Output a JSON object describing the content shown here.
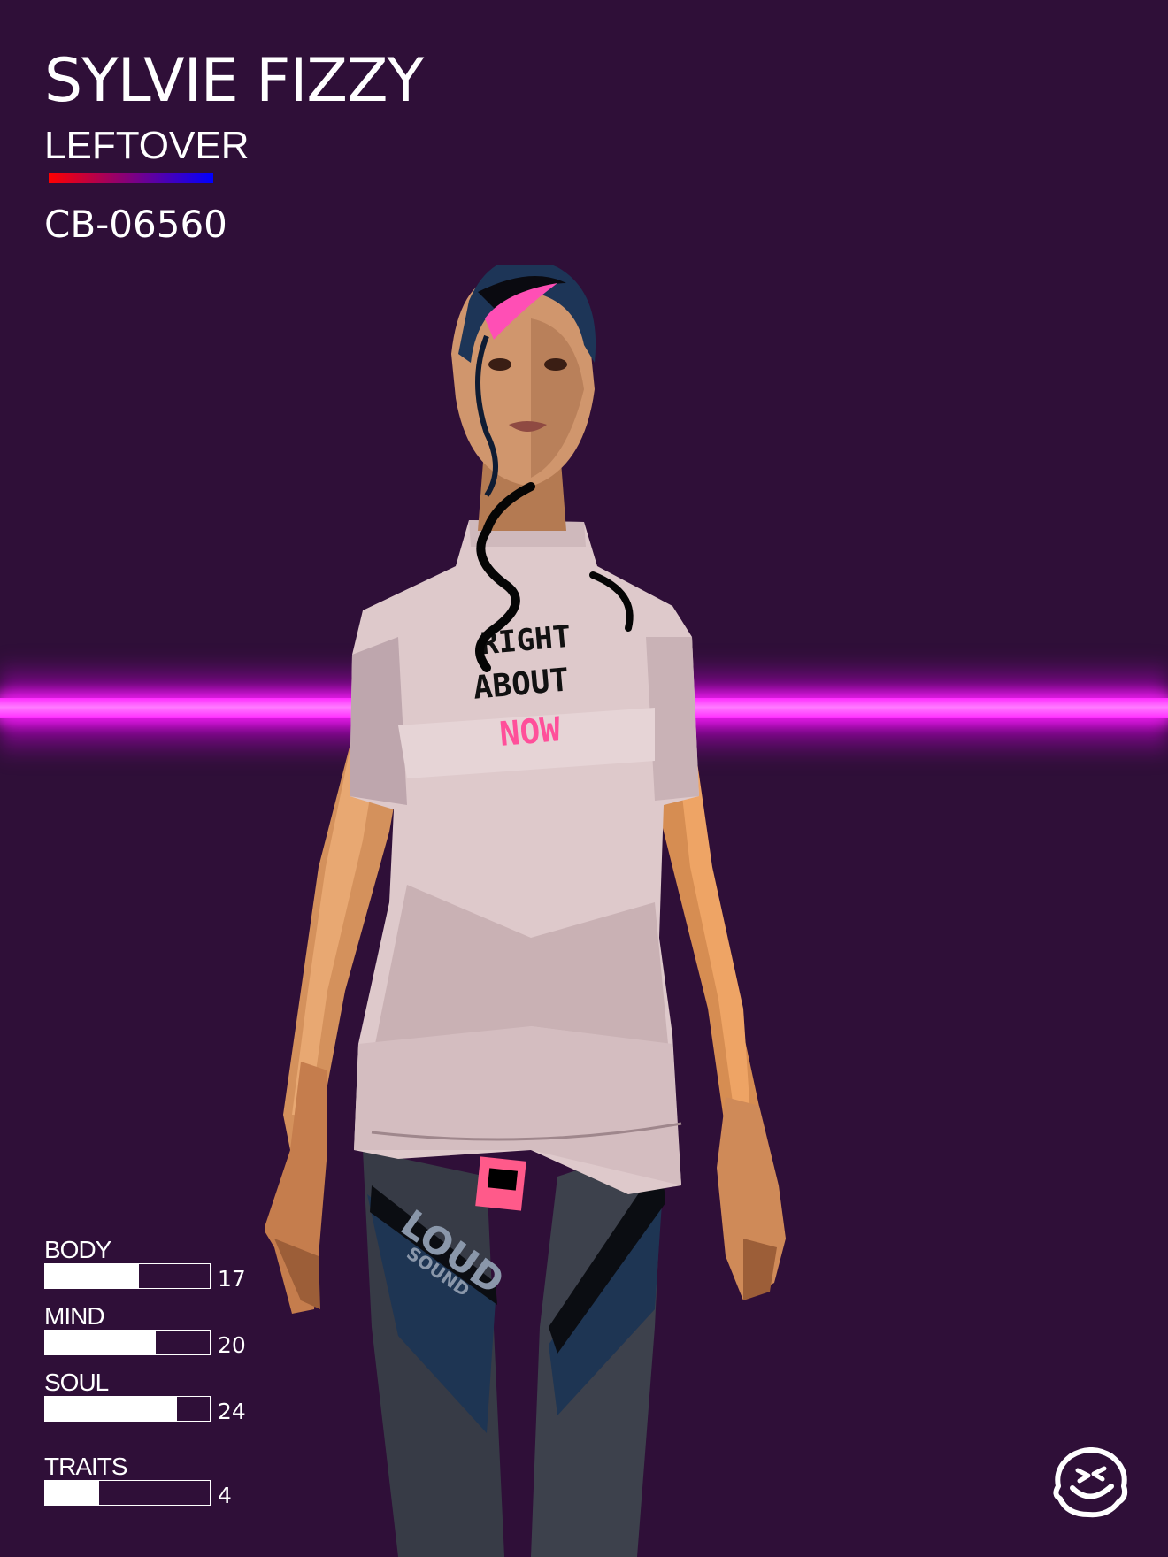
{
  "card": {
    "name": "SYLVIE FIZZY",
    "class_label": "LEFTOVER",
    "code": "CB-06560"
  },
  "colors": {
    "background": "#2f0f38",
    "neon": "#ff2cff",
    "class_gradient_start": "#ff0000",
    "class_gradient_end": "#0000ff",
    "stat_fill": "#ffffff"
  },
  "shirt": {
    "line1": "RIGHT",
    "line2": "ABOUT",
    "line3": "NOW"
  },
  "leggings": {
    "brand_line1": "LOUD",
    "brand_line2": "SOUND"
  },
  "stats": [
    {
      "label": "BODY",
      "value": 17,
      "fill_pct": 57
    },
    {
      "label": "MIND",
      "value": 20,
      "fill_pct": 67
    },
    {
      "label": "SOUL",
      "value": 24,
      "fill_pct": 80
    },
    {
      "label": "TRAITS",
      "value": 4,
      "fill_pct": 33
    }
  ],
  "logo": {
    "icon": "smiley-face-icon"
  }
}
